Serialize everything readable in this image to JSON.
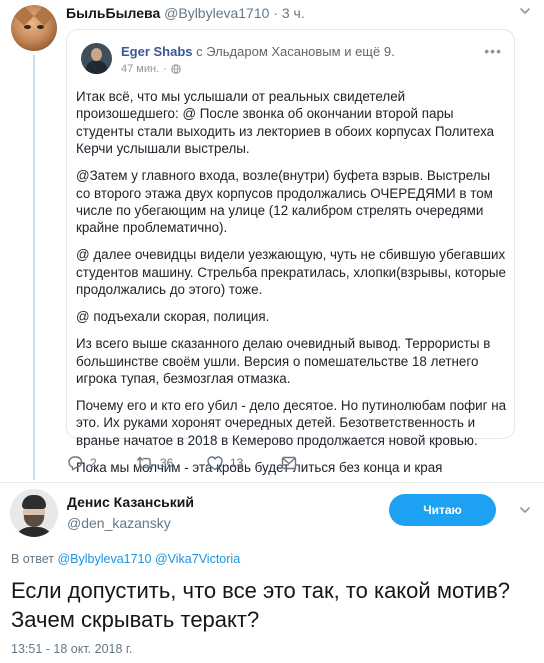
{
  "parent_tweet": {
    "name": "БыльБылева",
    "handle": "@Bylbyleva1710",
    "separator": "·",
    "time": "3 ч.",
    "actions": {
      "replies": "2",
      "retweets": "36",
      "likes": "13"
    }
  },
  "quoted_post": {
    "author": "Eger Shabs",
    "with_text": "с Эльдаром Хасановым и ещё 9.",
    "time": "47 мин.",
    "meta_dot": "·",
    "more": "•••",
    "paragraphs": [
      "Итак всё, что мы услышали от реальных свидетелей произошедшего: @ После звонка об окончании второй пары студенты стали выходить из лекториев в обоих корпусах Политеха Керчи услышали выстрелы.",
      "@Затем у главного входа, возле(внутри) буфета взрыв. Выстрелы со второго этажа двух корпусов продолжались ОЧЕРЕДЯМИ в том числе по убегающим на улице (12 калибром стрелять очередями крайне проблематично).",
      "@ далее очевидцы видели уезжающую, чуть не сбившую убегавших студентов машину. Стрельба прекратилась, хлопки(взрывы, которые продолжались до этого) тоже.",
      "@ подъехали скорая, полиция.",
      "Из всего выше сказанного делаю очевидный вывод. Террористы в большинстве своём ушли. Версия о помешательстве 18 летнего игрока тупая, безмозглая отмазка.",
      "Почему его и кто его убил - дело десятое. Но путинолюбам пофиг на это. Их руками хоронят очередных детей. Безответственность и вранье начатое в 2018 в Кемерово продолжается новой кровью.",
      "Пока мы молчим - эта кровь будет литься без конца и края"
    ]
  },
  "main_tweet": {
    "name": "Денис Казанський",
    "handle": "@den_kazansky",
    "follow_label": "Читаю",
    "reply_prefix": "В ответ",
    "reply_mention_1": "@Bylbyleva1710",
    "reply_and": "@",
    "reply_mention_2": "Vika7Victoria",
    "text": "Если допустить, что все это так, то какой мотив? Зачем скрывать теракт?",
    "timestamp": "13:51 - 18 окт. 2018 г."
  },
  "colors": {
    "accent": "#1da1f2",
    "link": "#1b95e0",
    "fb_name": "#385898",
    "thread_line": "#c4dff3"
  },
  "icons": [
    "reply-icon",
    "retweet-icon",
    "like-icon",
    "message-icon",
    "chevron-down-icon",
    "globe-icon"
  ]
}
